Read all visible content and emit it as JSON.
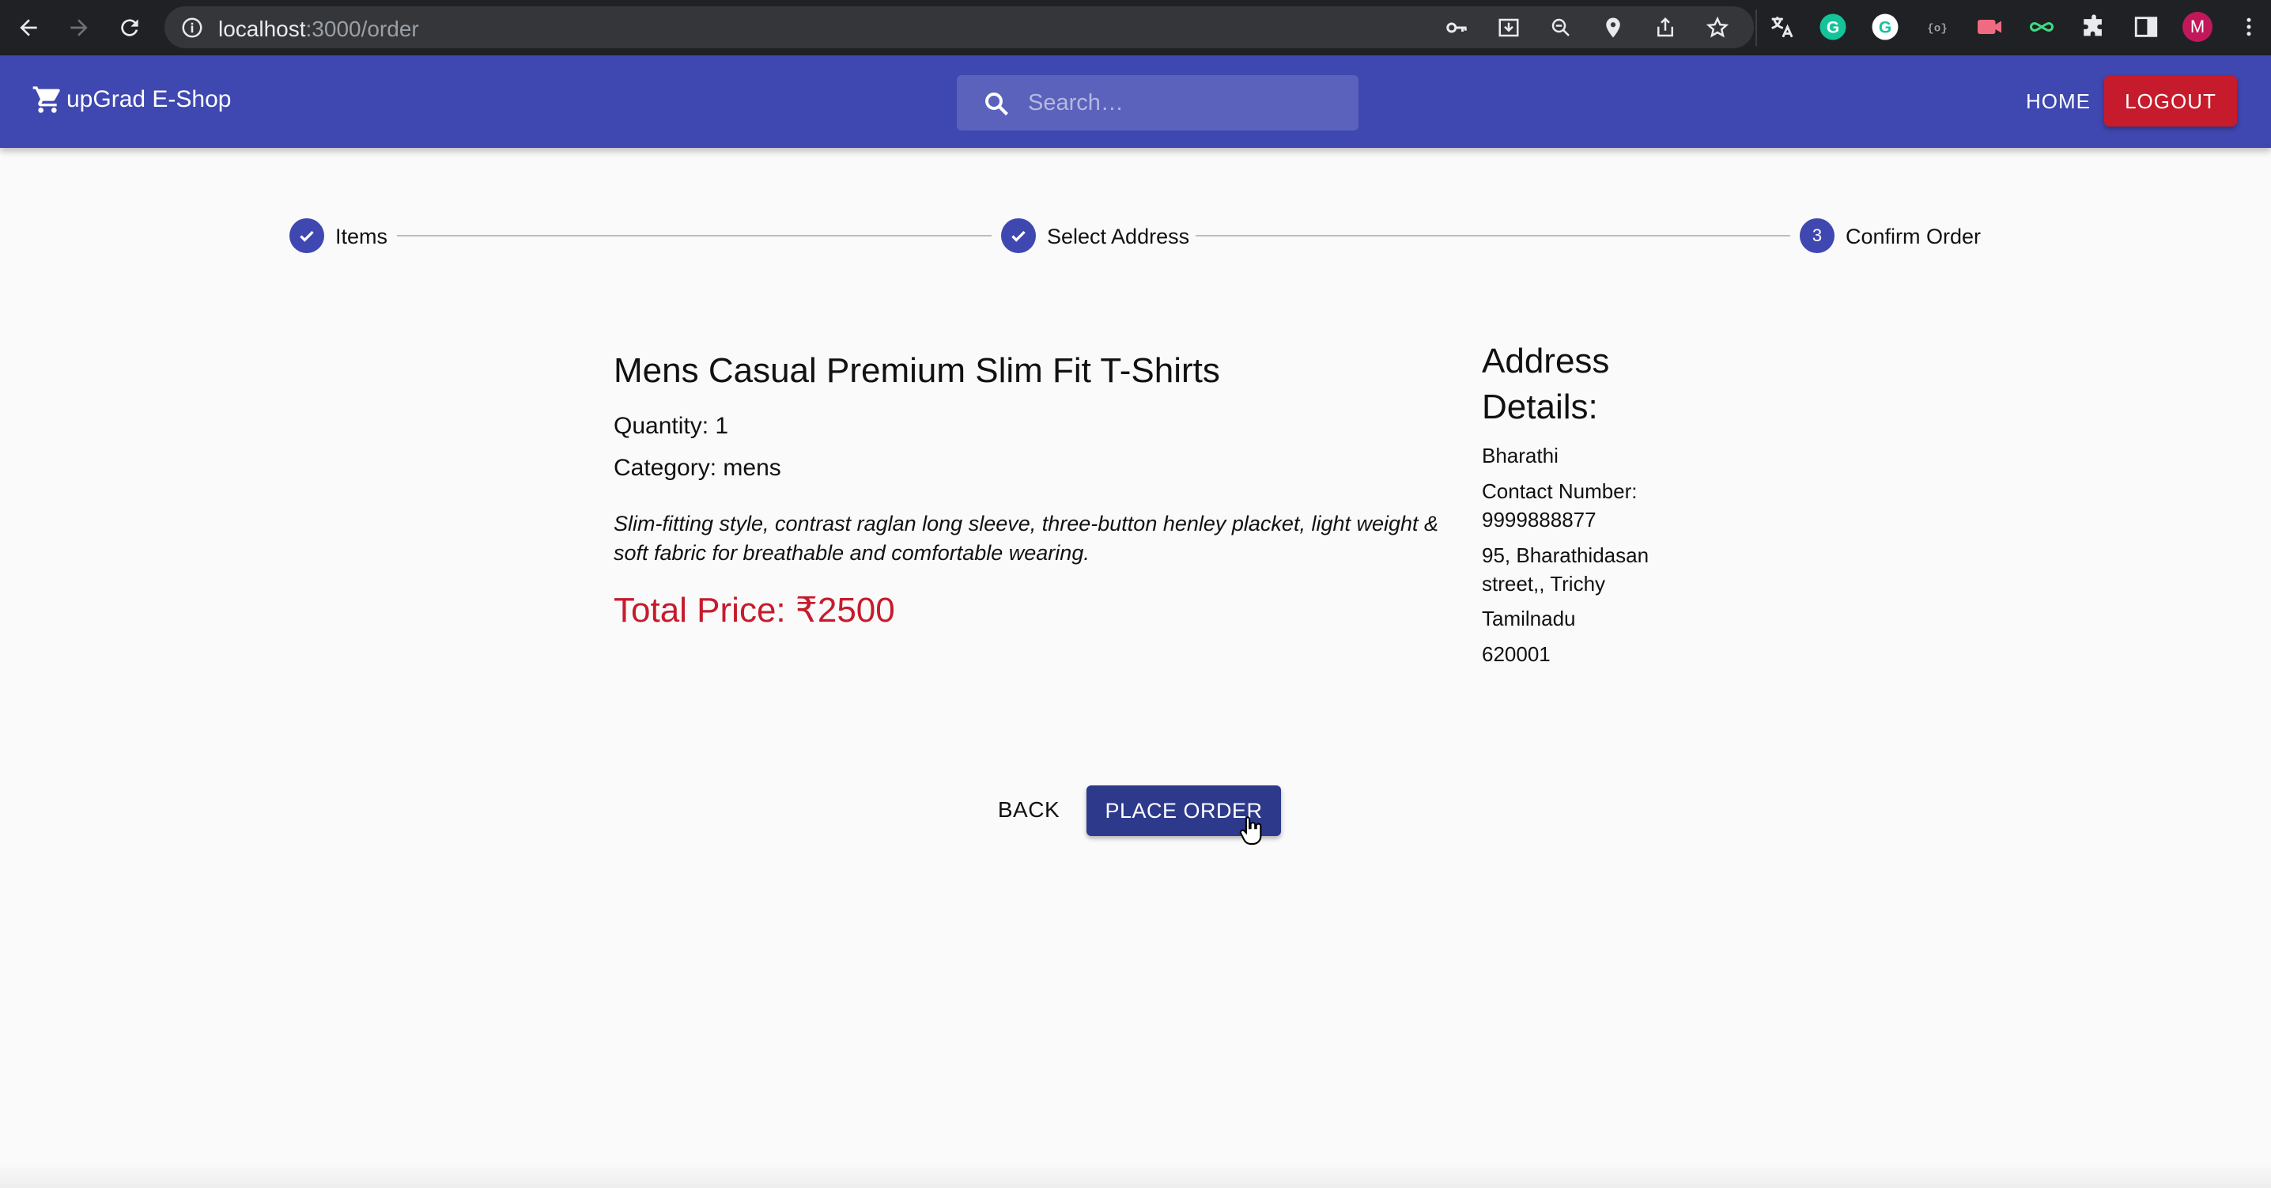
{
  "browser": {
    "url_host": "localhost",
    "url_path": ":3000/order",
    "profile_initial": "M"
  },
  "appbar": {
    "brand": "upGrad E-Shop",
    "search_placeholder": "Search…",
    "home_label": "HOME",
    "logout_label": "LOGOUT",
    "accent_color": "#3f47b0",
    "logout_color": "#c61b2c"
  },
  "stepper": {
    "steps": [
      {
        "label": "Items",
        "state": "completed"
      },
      {
        "label": "Select Address",
        "state": "completed"
      },
      {
        "label": "Confirm Order",
        "state": "active",
        "number": "3"
      }
    ]
  },
  "order": {
    "product_name": "Mens Casual Premium Slim Fit T-Shirts",
    "quantity_text": "Quantity: 1",
    "category_text": "Category: mens",
    "description": "Slim-fitting style, contrast raglan long sleeve, three-button henley placket, light weight & soft fabric for breathable and comfortable wearing.",
    "total_price_text": "Total Price: ₹2500"
  },
  "address": {
    "heading": "Address Details:",
    "name": "Bharathi",
    "contact": "Contact Number: 9999888877",
    "street": "95, Bharathidasan street,, Trichy",
    "state": "Tamilnadu",
    "pincode": "620001"
  },
  "actions": {
    "back_label": "BACK",
    "place_order_label": "PLACE ORDER"
  }
}
